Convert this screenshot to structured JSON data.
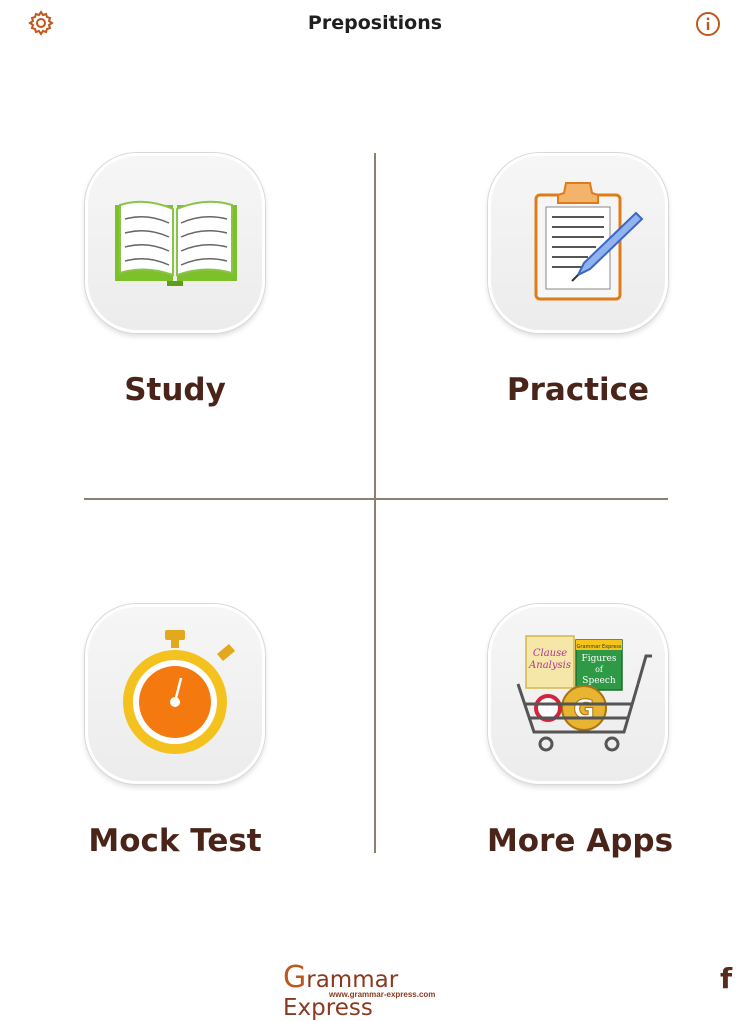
{
  "header": {
    "title": "Prepositions"
  },
  "tiles": [
    {
      "label": "Study"
    },
    {
      "label": "Practice"
    },
    {
      "label": "Mock Test"
    },
    {
      "label": "More Apps"
    }
  ],
  "more_apps_icon": {
    "app1_line1": "Clause",
    "app1_line2": "Analysis",
    "app2_brand": "Grammar Express",
    "app2_line1": "Figures",
    "app2_line2": "of",
    "app2_line3": "Speech",
    "app3_letter": "G"
  },
  "footer": {
    "brand_first": "G",
    "brand_rest": "rammar Express",
    "url": "www.grammar-express.com",
    "facebook_glyph": "f"
  },
  "colors": {
    "label_text": "#4a2418",
    "divider": "#8b8170",
    "accent_orange": "#c0571c"
  }
}
